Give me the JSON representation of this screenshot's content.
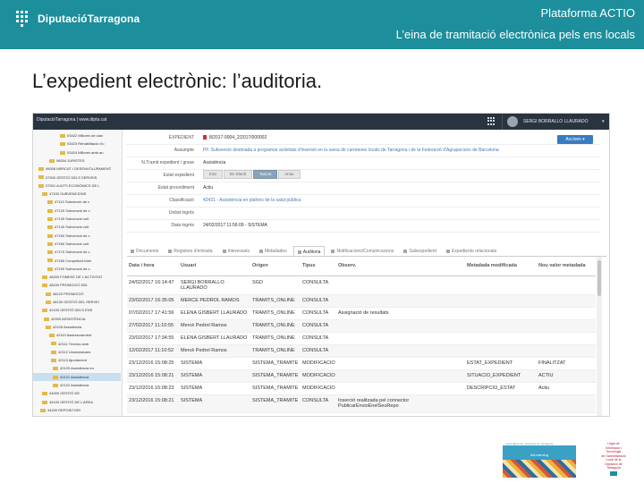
{
  "banner": {
    "logo_text": "DiputacióTarragona",
    "title": "Plataforma ACTIO",
    "subtitle": "L’eina de tramitació electrònica pels ens locals",
    "color": "#1c8e9c"
  },
  "page_title": "L’expedient electrònic: l’auditoria.",
  "app": {
    "brand": "DiputacióTarragona | www.dipta.cat",
    "user": "SERGI BORRALLO LLAURADO",
    "user_caret": "▾",
    "action_button": "Accions ▾",
    "tree": [
      "03422 Millores de clav.",
      "03423 Rehabilitació d'u",
      "03424 Millores amb au",
      "06004 JURISTES",
      "06006 MERCAT I DESENVOLUPAMENT",
      "07000 GESTIÓ DELS SERVEIS ",
      "07001 AJUTS ECONÒMICS DE L",
      "47100 SUBVENCIONS",
      "47110 Subvenció de c",
      "47120 Subvenció de c",
      "47130 Subvenció cult",
      "47140 Subvenció cult",
      "47150 Subvenció de c",
      "47160 Subvenció cult",
      "47170 Subvenció de c",
      "47180 Competició inter",
      "47190 Subvenció de c",
      "48200 FOMENT DE L’ACTIVITAT",
      "48100 PROMOCIÓ DEL",
      "48120 PROMOCIÓ",
      "48130 GESTIÓ DEL SERVEI",
      "42100 GESTIÓ DELS ENS",
      "42000 ASSISTÈNCIA",
      "42105 Assistència",
      "42110 Assessorament",
      "42111 Tècnics amb",
      "42112 Llicenciatures",
      "42113 Ajuntament",
      "42120 Assistència en",
      "42121 Assistència",
      "42122 Assistència",
      "44000 GESTIÓ DE",
      "44100 GESTIÓ DE L’AREA",
      "44200 REPOSITORI"
    ],
    "details": [
      {
        "label": "EXPEDIENT",
        "value": "8/2017-0004_2/2017/000002"
      },
      {
        "label": "Assumpte",
        "value": "PF. Subvenció destinada a programar activitats d'inversió en la xarxa de carreteres locals de Tarragona i de la Federació d'Agrupacions de Barcelona"
      },
      {
        "label": "N.Tramit expedient / grave",
        "value": "Assistència"
      },
      {
        "label": "Estat expedient",
        "value": ""
      },
      {
        "label": "Estat procediment",
        "value": "Actiu"
      },
      {
        "label": "Classificació",
        "value": "42421 - Assistència en plafons de la salut pública"
      },
      {
        "label": "Unitat ingrés",
        "value": ""
      },
      {
        "label": "Data ingrés",
        "value": "24/02/2017 11:56:09 - SISTEMA"
      }
    ],
    "steps": [
      "Inici",
      "En tràmit",
      "Tancat",
      "Arxiu"
    ],
    "tabs": [
      "Documents",
      "Registres d'entrada",
      "Interessats",
      "Metadades",
      "Auditoria",
      "Notificacions/Comunicacions",
      "Subexpedient",
      "Expedients relacionats"
    ],
    "table_headers": [
      "Data i hora",
      "Usuari",
      "Origen",
      "Tipus",
      "Observ.",
      "Metadada modificada",
      "Nou valor metadada"
    ],
    "table_rows": [
      [
        "24/02/2017 16:14:47",
        "SERGI BORRALLO LLAURADO",
        "SGD",
        "CONSULTA",
        "",
        "",
        ""
      ],
      [
        "23/02/2017 16:35:05",
        "MERCÈ PEDROL RAMOS",
        "TRAMITS_ONLINE",
        "CONSULTA",
        "",
        "",
        ""
      ],
      [
        "07/02/2017 17:41:56",
        "ELENA GISBERT LLAURADÓ",
        "TRAMITS_ONLINE",
        "CONSULTA",
        "Assignació de resultats",
        "",
        ""
      ],
      [
        "27/02/2017 11:10:55",
        "Mercè Pedrol Ramos",
        "TRAMITS_ONLINE",
        "CONSULTA",
        "",
        "",
        ""
      ],
      [
        "23/02/2017 17:34:55",
        "ELENA GISBERT LLAURADÓ",
        "TRAMITS_ONLINE",
        "CONSULTA",
        "",
        "",
        ""
      ],
      [
        "12/02/2017 11:10:52",
        "Mercè Pedrol Ramos",
        "TRAMITS_ONLINE",
        "CONSULTA",
        "",
        "",
        ""
      ],
      [
        "23/12/2016 15:08:25",
        "SISTEMA",
        "SISTEMA_TRAMITE",
        "MODIFICACIO",
        "",
        "ESTAT_EXPEDIENT",
        "FINALITZAT"
      ],
      [
        "23/12/2016 15:08:21",
        "SISTEMA",
        "SISTEMA_TRAMITE",
        "MODIFICACIO",
        "",
        "SITUACIO_EXPEDIENT",
        "ACTIU"
      ],
      [
        "23/12/2016 15:08:23",
        "SISTEMA",
        "SISTEMA_TRAMITE",
        "MODIFICACIO",
        "",
        "DESCRIPCIO_ESTAT",
        "Actiu"
      ],
      [
        "23/12/2016 15:08:21",
        "SISTEMA",
        "SISTEMA_TRAMITE",
        "CONSULTA",
        "Inserció realitzada pel connector PublicarEnvioEnelSeuRepo",
        "",
        ""
      ]
    ]
  },
  "promo": {
    "head": "www.dipta.cat · Diputació de Tarragona",
    "tag": "#eLearning"
  },
  "seal": {
    "lines": [
      "Lligat de",
      "Informació i",
      "Tecnologia",
      "de l’Administració",
      "Local de la",
      "Diputació de",
      "Tarragona"
    ]
  }
}
